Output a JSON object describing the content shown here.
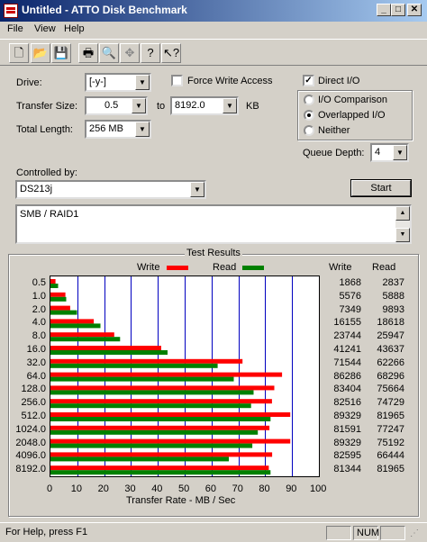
{
  "window": {
    "title": "Untitled - ATTO Disk Benchmark",
    "controls": {
      "minimize": "_",
      "maximize": "□",
      "close": "✕"
    }
  },
  "menu": {
    "items": [
      "File",
      "View",
      "Help"
    ]
  },
  "toolbar": {
    "icons": [
      "new-icon",
      "open-icon",
      "save-icon",
      "print-icon",
      "print-preview-icon",
      "move-icon",
      "help-icon",
      "context-help-icon"
    ]
  },
  "form": {
    "drive_label": "Drive:",
    "drive_value": "[-y-]",
    "force_write_label": "Force Write Access",
    "force_write_checked": false,
    "direct_io_label": "Direct I/O",
    "direct_io_checked": true,
    "transfer_size_label": "Transfer Size:",
    "transfer_from": "0.5",
    "transfer_to_label": "to",
    "transfer_to": "8192.0",
    "transfer_unit": "KB",
    "total_length_label": "Total Length:",
    "total_length": "256 MB",
    "io_comparison_label": "I/O Comparison",
    "overlapped_io_label": "Overlapped I/O",
    "neither_label": "Neither",
    "io_mode_selected": "Overlapped I/O",
    "queue_depth_label": "Queue Depth:",
    "queue_depth": "4",
    "controlled_by_label": "Controlled by:",
    "controlled_by": "DS213j",
    "start_label": "Start",
    "description": "SMB / RAID1"
  },
  "results": {
    "group_title": "Test Results",
    "legend_write": "Write",
    "legend_read": "Read",
    "col_write": "Write",
    "col_read": "Read",
    "rows": [
      {
        "size": "0.5",
        "write": "1868",
        "read": "2837"
      },
      {
        "size": "1.0",
        "write": "5576",
        "read": "5888"
      },
      {
        "size": "2.0",
        "write": "7349",
        "read": "9893"
      },
      {
        "size": "4.0",
        "write": "16155",
        "read": "18618"
      },
      {
        "size": "8.0",
        "write": "23744",
        "read": "25947"
      },
      {
        "size": "16.0",
        "write": "41241",
        "read": "43637"
      },
      {
        "size": "32.0",
        "write": "71544",
        "read": "62266"
      },
      {
        "size": "64.0",
        "write": "86286",
        "read": "68296"
      },
      {
        "size": "128.0",
        "write": "83404",
        "read": "75664"
      },
      {
        "size": "256.0",
        "write": "82516",
        "read": "74729"
      },
      {
        "size": "512.0",
        "write": "89329",
        "read": "81965"
      },
      {
        "size": "1024.0",
        "write": "81591",
        "read": "77247"
      },
      {
        "size": "2048.0",
        "write": "89329",
        "read": "75192"
      },
      {
        "size": "4096.0",
        "write": "82595",
        "read": "66444"
      },
      {
        "size": "8192.0",
        "write": "81344",
        "read": "81965"
      }
    ],
    "x_ticks": [
      "0",
      "10",
      "20",
      "30",
      "40",
      "50",
      "60",
      "70",
      "80",
      "90",
      "100"
    ],
    "x_label": "Transfer Rate - MB / Sec"
  },
  "chart_data": {
    "type": "bar",
    "categories": [
      "0.5",
      "1.0",
      "2.0",
      "4.0",
      "8.0",
      "16.0",
      "32.0",
      "64.0",
      "128.0",
      "256.0",
      "512.0",
      "1024.0",
      "2048.0",
      "4096.0",
      "8192.0"
    ],
    "series": [
      {
        "name": "Write",
        "color": "#ff0000",
        "values": [
          1.868,
          5.576,
          7.349,
          16.155,
          23.744,
          41.241,
          71.544,
          86.286,
          83.404,
          82.516,
          89.329,
          81.591,
          89.329,
          82.595,
          81.344
        ]
      },
      {
        "name": "Read",
        "color": "#008000",
        "values": [
          2.837,
          5.888,
          9.893,
          18.618,
          25.947,
          43.637,
          62.266,
          68.296,
          75.664,
          74.729,
          81.965,
          77.247,
          75.192,
          66.444,
          81.965
        ]
      }
    ],
    "xlabel": "Transfer Rate - MB / Sec",
    "xlim": [
      0,
      100
    ],
    "orientation": "horizontal"
  },
  "status": {
    "help_text": "For Help, press F1",
    "num_indicator": "NUM"
  }
}
